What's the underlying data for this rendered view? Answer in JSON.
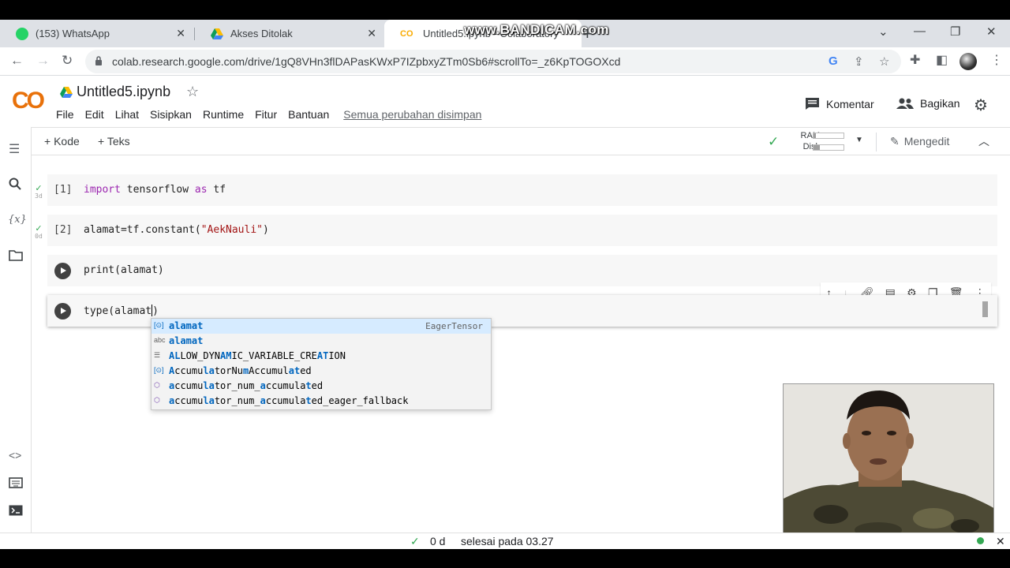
{
  "browser": {
    "tabs": [
      {
        "label": "(153) WhatsApp",
        "icon": "whatsapp-icon"
      },
      {
        "label": "Akses Ditolak",
        "icon": "google-drive-icon"
      },
      {
        "label": "Untitled5.ipynb - Colaboratory",
        "icon": "colab-icon"
      }
    ],
    "recording_watermark": "www.BANDICAM.com",
    "url": "colab.research.google.com/drive/1gQ8VHn3flDAPasKWxP7IZpbxyZTm0Sb6#scrollTo=_z6KpTOGOXcd"
  },
  "colab": {
    "logo": "CO",
    "notebook_title": "Untitled5.ipynb",
    "menu": [
      "File",
      "Edit",
      "Lihat",
      "Sisipkan",
      "Runtime",
      "Fitur",
      "Bantuan"
    ],
    "saved_status": "Semua perubahan disimpan",
    "comment_label": "Komentar",
    "share_label": "Bagikan",
    "add_code_label": "+ Kode",
    "add_text_label": "+ Teks",
    "ram_label": "RAM",
    "disk_label": "Disk",
    "ram_usage": 0.08,
    "disk_usage": 0.22,
    "edit_mode_label": "Mengedit"
  },
  "cells": [
    {
      "count": "[1]",
      "code_kw": "import",
      "code_mid": " tensorflow ",
      "code_kw2": "as",
      "code_end": " tf",
      "status_time": "3d"
    },
    {
      "count": "[2]",
      "code_pre": "alamat=tf.constant(",
      "code_str": "\"AekNauli\"",
      "code_post": ")",
      "status_time": "0d"
    },
    {
      "code": "print(alamat)"
    },
    {
      "code_pre": "type(alamat",
      "code_post": ")"
    }
  ],
  "autocomplete": {
    "items": [
      {
        "icon": "[⊙]",
        "label": "alamat",
        "detail": "EagerTensor"
      },
      {
        "icon": "abc",
        "label": "alamat"
      },
      {
        "icon": "☰",
        "label": "ALLOW_DYNAMIC_VARIABLE_CREATION"
      },
      {
        "icon": "[⊙]",
        "label": "AccumulatorNumAccumulated"
      },
      {
        "icon": "⬡",
        "label": "accumulator_num_accumulated"
      },
      {
        "icon": "⬡",
        "label": "accumulator_num_accumulated_eager_fallback"
      }
    ]
  },
  "statusbar": {
    "elapsed": "0 d",
    "finished": "selesai pada 03.27"
  }
}
